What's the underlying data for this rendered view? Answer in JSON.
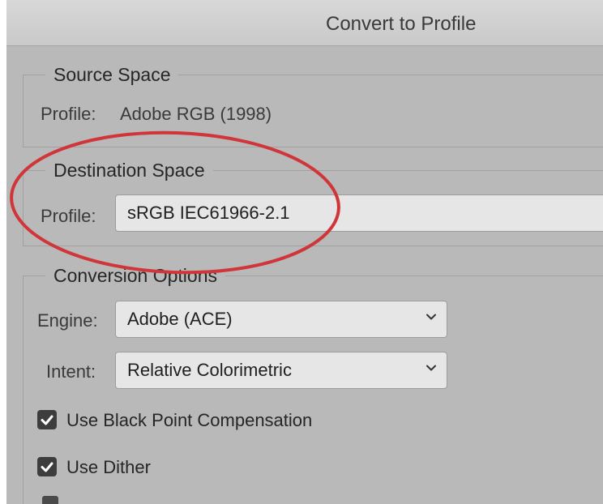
{
  "dialog": {
    "title": "Convert to Profile"
  },
  "source_space": {
    "legend": "Source Space",
    "profile_label": "Profile:",
    "profile_value": "Adobe RGB (1998)"
  },
  "destination_space": {
    "legend": "Destination Space",
    "profile_label": "Profile:",
    "profile_value": "sRGB IEC61966-2.1"
  },
  "conversion_options": {
    "legend": "Conversion Options",
    "engine_label": "Engine:",
    "engine_value": "Adobe (ACE)",
    "intent_label": "Intent:",
    "intent_value": "Relative Colorimetric",
    "black_point_label": "Use Black Point Compensation",
    "black_point_checked": true,
    "dither_label": "Use Dither",
    "dither_checked": true
  },
  "colors": {
    "annotation_ellipse": "#d0353a",
    "dialog_background": "#b9b9b9",
    "checkbox_fill": "#3d3d3d"
  },
  "icons": {
    "dropdown": "chevron-down-icon",
    "checkbox": "checkmark-icon",
    "annotation": "ellipse-highlight"
  }
}
